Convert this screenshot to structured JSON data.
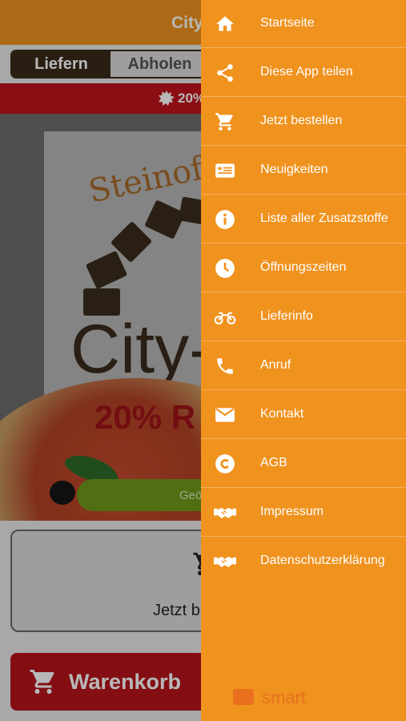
{
  "topbar": {
    "title": "City"
  },
  "order_mode": {
    "deliver_label": "Liefern",
    "pickup_label": "Abholen"
  },
  "promo_banner": {
    "text": "20%"
  },
  "hero": {
    "brand_text": "Steinof",
    "city_text": "City-",
    "promo_text": "20% R",
    "button_label": "Geö"
  },
  "order_box": {
    "text": "Jetzt b"
  },
  "basket": {
    "label": "Warenkorb"
  },
  "drawer": {
    "items": [
      {
        "label": "Startseite",
        "icon": "home-icon"
      },
      {
        "label": "Diese App teilen",
        "icon": "share-icon"
      },
      {
        "label": "Jetzt bestellen",
        "icon": "cart-icon"
      },
      {
        "label": "Neuigkeiten",
        "icon": "news-icon"
      },
      {
        "label": "Liste aller Zusatzstoffe",
        "icon": "info-icon"
      },
      {
        "label": "Öffnungszeiten",
        "icon": "clock-icon"
      },
      {
        "label": "Lieferinfo",
        "icon": "motorbike-icon"
      },
      {
        "label": "Anruf",
        "icon": "phone-icon"
      },
      {
        "label": "Kontakt",
        "icon": "mail-icon"
      },
      {
        "label": "AGB",
        "icon": "copyright-icon"
      },
      {
        "label": "Impressum",
        "icon": "handshake-icon"
      },
      {
        "label": "Datenschutzerklärung",
        "icon": "handshake-icon"
      }
    ],
    "footer_logo": "smart"
  },
  "colors": {
    "accent": "#f0921e",
    "brand_red": "#c0141c",
    "brand_brown": "#3b2a1a",
    "cta_green": "#6e9a1a"
  }
}
